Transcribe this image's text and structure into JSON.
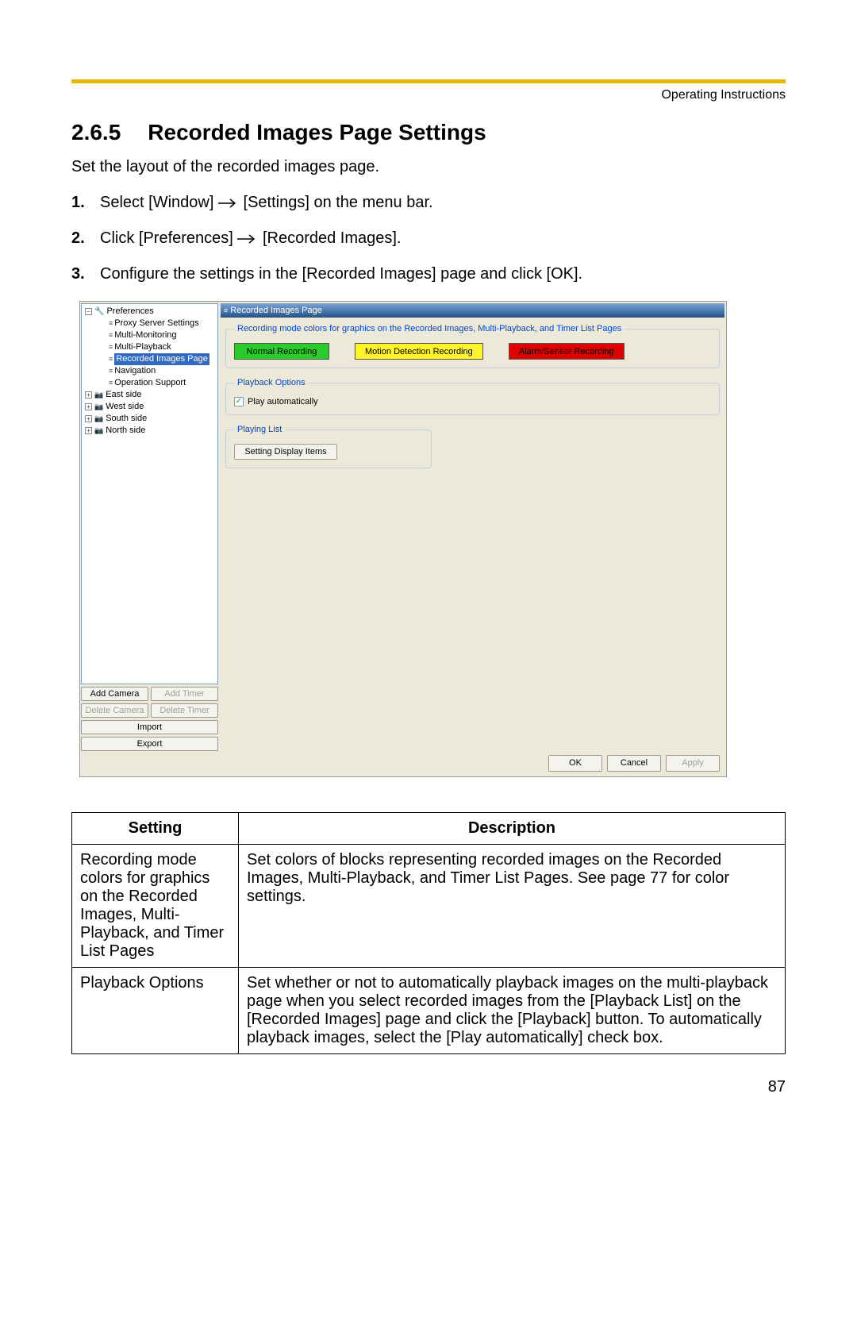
{
  "header": {
    "running": "Operating Instructions"
  },
  "section": {
    "number": "2.6.5",
    "title": "Recorded Images Page Settings"
  },
  "intro": "Set the layout of the recorded images page.",
  "steps": {
    "s1a": "Select [Window] ",
    "s1b": " [Settings] on the menu bar.",
    "s2a": "Click [Preferences] ",
    "s2b": " [Recorded Images].",
    "s3": "Configure the settings in the [Recorded Images] page and click [OK]."
  },
  "tree": {
    "root": "Preferences",
    "items": [
      "Proxy Server Settings",
      "Multi-Monitoring",
      "Multi-Playback",
      "Recorded Images Page",
      "Navigation",
      "Operation Support"
    ],
    "cams": [
      "East side",
      "West side",
      "South side",
      "North side"
    ]
  },
  "leftButtons": {
    "addCamera": "Add Camera",
    "addTimer": "Add Timer",
    "deleteCamera": "Delete Camera",
    "deleteTimer": "Delete Timer",
    "import": "Import",
    "export": "Export"
  },
  "rightPanel": {
    "title": "Recorded Images Page",
    "fs1": {
      "legend": "Recording mode colors for graphics on the Recorded Images, Multi-Playback, and Timer List Pages",
      "chip1": "Normal Recording",
      "chip2": "Motion Detection Recording",
      "chip3": "Alarm/Sensor Recording"
    },
    "fs2": {
      "legend": "Playback Options",
      "chk": "Play automatically"
    },
    "fs3": {
      "legend": "Playing List",
      "btn": "Setting Display Items"
    }
  },
  "dialog": {
    "ok": "OK",
    "cancel": "Cancel",
    "apply": "Apply"
  },
  "table": {
    "h1": "Setting",
    "h2": "Description",
    "r1s": "Recording mode colors for graphics on the Recorded Images, Multi-Playback, and Timer List Pages",
    "r1d": "Set colors of blocks representing recorded images on the Recorded Images, Multi-Playback, and Timer List Pages. See page 77 for color settings.",
    "r2s": "Playback Options",
    "r2d": "Set whether or not to automatically playback images on the multi-playback page when you select recorded images from the [Playback List] on the [Recorded Images] page and click the [Playback] button. To automatically playback images, select the [Play automatically] check box."
  },
  "pagenum": "87"
}
